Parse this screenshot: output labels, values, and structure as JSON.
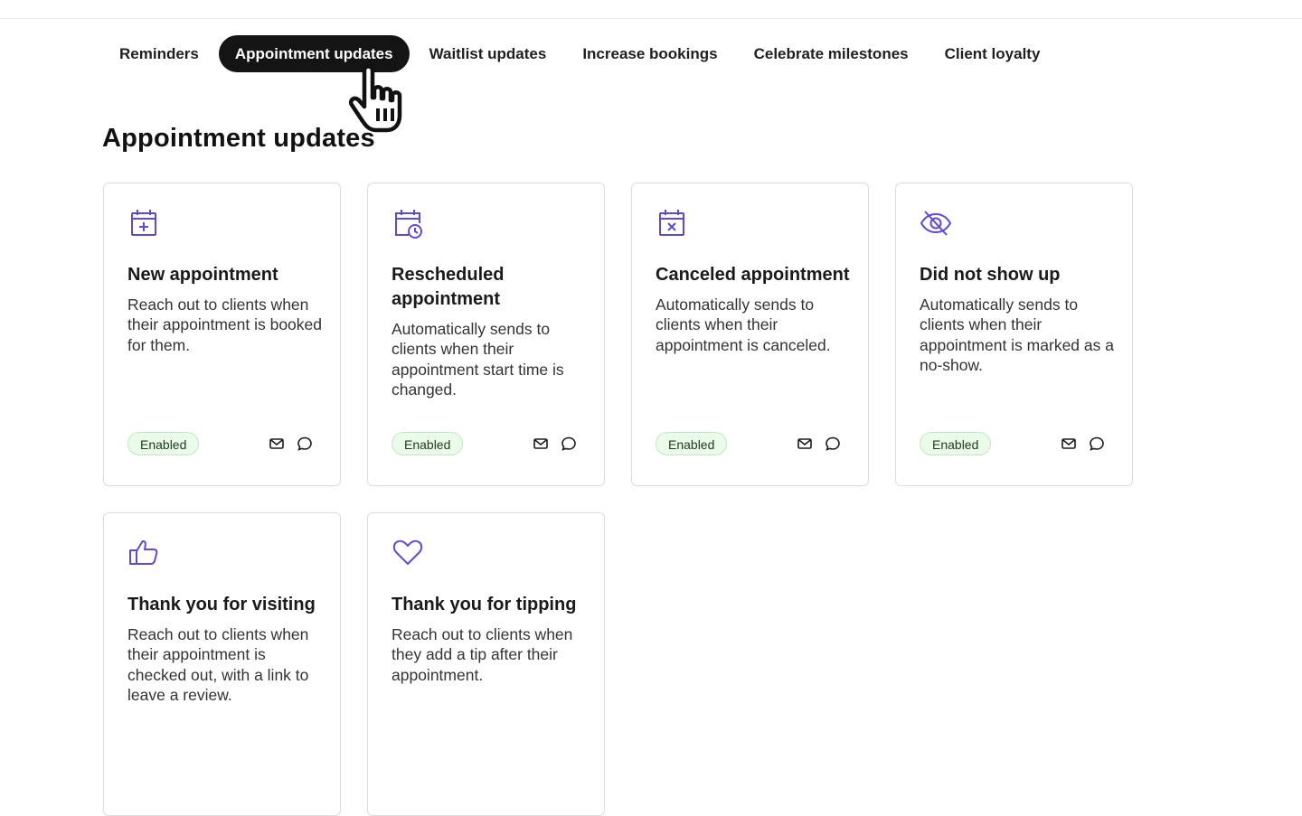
{
  "tabs": [
    {
      "label": "Reminders",
      "active": false
    },
    {
      "label": "Appointment updates",
      "active": true
    },
    {
      "label": "Waitlist updates",
      "active": false
    },
    {
      "label": "Increase bookings",
      "active": false
    },
    {
      "label": "Celebrate milestones",
      "active": false
    },
    {
      "label": "Client loyalty",
      "active": false
    }
  ],
  "section": {
    "title": "Appointment updates"
  },
  "accent_color": "#5b4bd8",
  "cards": [
    {
      "icon": "calendar-plus-icon",
      "title": "New appointment",
      "description": "Reach out to clients when their appointment is booked for them.",
      "status": "Enabled",
      "channels": [
        "email-icon",
        "sms-icon"
      ]
    },
    {
      "icon": "calendar-clock-icon",
      "title": "Rescheduled appointment",
      "description": "Automatically sends to clients when their appointment start time is changed.",
      "status": "Enabled",
      "channels": [
        "email-icon",
        "sms-icon"
      ]
    },
    {
      "icon": "calendar-x-icon",
      "title": "Canceled appointment",
      "description": "Automatically sends to clients when their appointment is canceled.",
      "status": "Enabled",
      "channels": [
        "email-icon",
        "sms-icon"
      ]
    },
    {
      "icon": "eye-off-icon",
      "title": "Did not show up",
      "description": "Automatically sends to clients when their appointment is marked as a no-show.",
      "status": "Enabled",
      "channels": [
        "email-icon",
        "sms-icon"
      ]
    },
    {
      "icon": "thumbs-up-icon",
      "title": "Thank you for visiting",
      "description": "Reach out to clients when their appointment is checked out, with a link to leave a review."
    },
    {
      "icon": "heart-icon",
      "title": "Thank you for tipping",
      "description": "Reach out to clients when they add a tip after their appointment."
    }
  ]
}
